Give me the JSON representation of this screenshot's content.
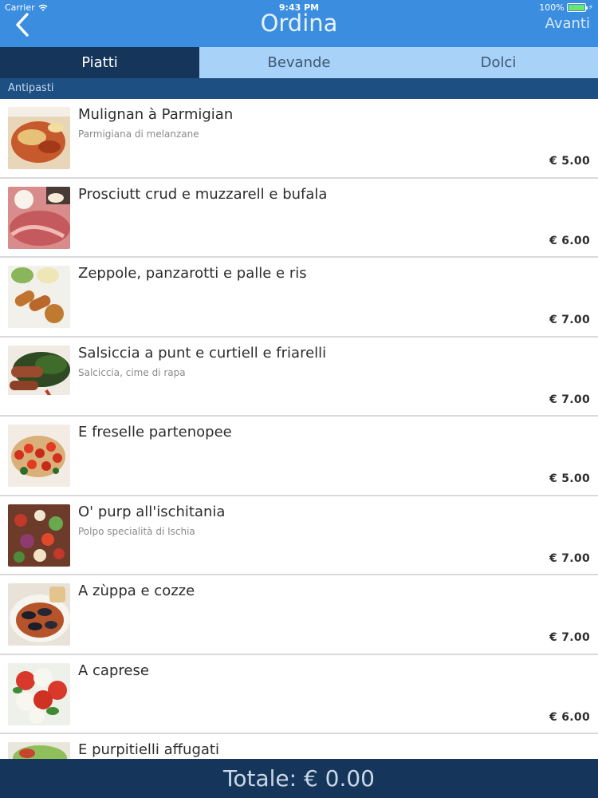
{
  "status_bar": {
    "carrier": "Carrier",
    "time": "9:43 PM",
    "battery": "100%",
    "battery_level": 1.0,
    "charge_icon": "lightning-icon"
  },
  "nav": {
    "back_icon": "chevron-left-icon",
    "title": "Ordina",
    "next_label": "Avanti"
  },
  "tabs": [
    {
      "label": "Piatti",
      "active": true
    },
    {
      "label": "Bevande",
      "active": false
    },
    {
      "label": "Dolci",
      "active": false
    }
  ],
  "section": {
    "title": "Antipasti"
  },
  "items": [
    {
      "name": "Mulignan à Parmigian",
      "description": "Parmigiana di melanzane",
      "price": "€ 5.00",
      "image": "eggplant-parmigiana"
    },
    {
      "name": "Prosciutt crud e muzzarell e bufala",
      "description": "",
      "price": "€ 6.00",
      "image": "prosciutto-mozzarella"
    },
    {
      "name": "Zeppole, panzarotti e palle e ris",
      "description": "",
      "price": "€ 7.00",
      "image": "fried-croquettes"
    },
    {
      "name": "Salsiccia a punt e curtiell e friarelli",
      "description": "Salciccia, cime di rapa",
      "price": "€ 7.00",
      "image": "sausage-greens"
    },
    {
      "name": "E freselle partenopee",
      "description": "",
      "price": "€ 5.00",
      "image": "freselle-tomato"
    },
    {
      "name": "O' purp all'ischitania",
      "description": "Polpo specialità di Ischia",
      "price": "€ 7.00",
      "image": "octopus-salad"
    },
    {
      "name": "A zùppa e cozze",
      "description": "",
      "price": "€ 7.00",
      "image": "mussel-soup"
    },
    {
      "name": "A caprese",
      "description": "",
      "price": "€ 6.00",
      "image": "caprese"
    },
    {
      "name": "E purpitielli affugati",
      "description": "",
      "price": "",
      "image": "octopus-stew"
    }
  ],
  "footer": {
    "total_label": "Totale: € 0.00"
  },
  "colors": {
    "header": "#3a8ddf",
    "tab_active": "#15365a",
    "tab_inactive": "#a8d2f8",
    "section": "#1d4f82",
    "footer": "#15365a"
  }
}
